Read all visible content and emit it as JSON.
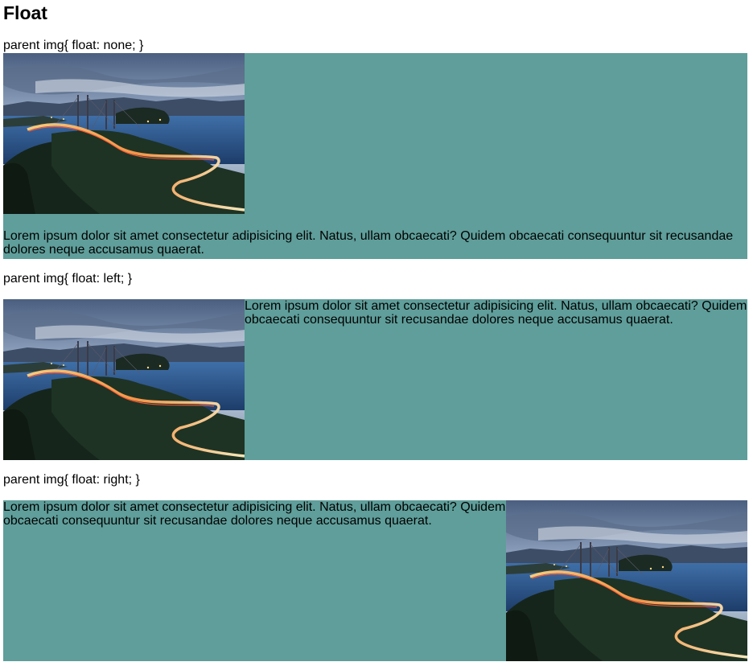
{
  "page": {
    "title": "Float"
  },
  "sections": [
    {
      "caption": "parent img{ float: none; }",
      "float": "none",
      "text": "Lorem ipsum dolor sit amet consectetur adipisicing elit. Natus, ullam obcaecati? Quidem obcaecati consequuntur sit recusandae dolores neque accusamus quaerat.",
      "image": "bridge-at-dusk-photo"
    },
    {
      "caption": "parent img{ float: left; }",
      "float": "left",
      "text": "Lorem ipsum dolor sit amet consectetur adipisicing elit. Natus, ullam obcaecati? Quidem obcaecati consequuntur sit recusandae dolores neque accusamus quaerat.",
      "image": "bridge-at-dusk-photo"
    },
    {
      "caption": "parent img{ float: right; }",
      "float": "right",
      "text": "Lorem ipsum dolor sit amet consectetur adipisicing elit. Natus, ullam obcaecati? Quidem obcaecati consequuntur sit recusandae dolores neque accusamus quaerat.",
      "image": "bridge-at-dusk-photo"
    }
  ],
  "colors": {
    "parent_background": "#5f9e9a",
    "page_background": "#ffffff"
  }
}
